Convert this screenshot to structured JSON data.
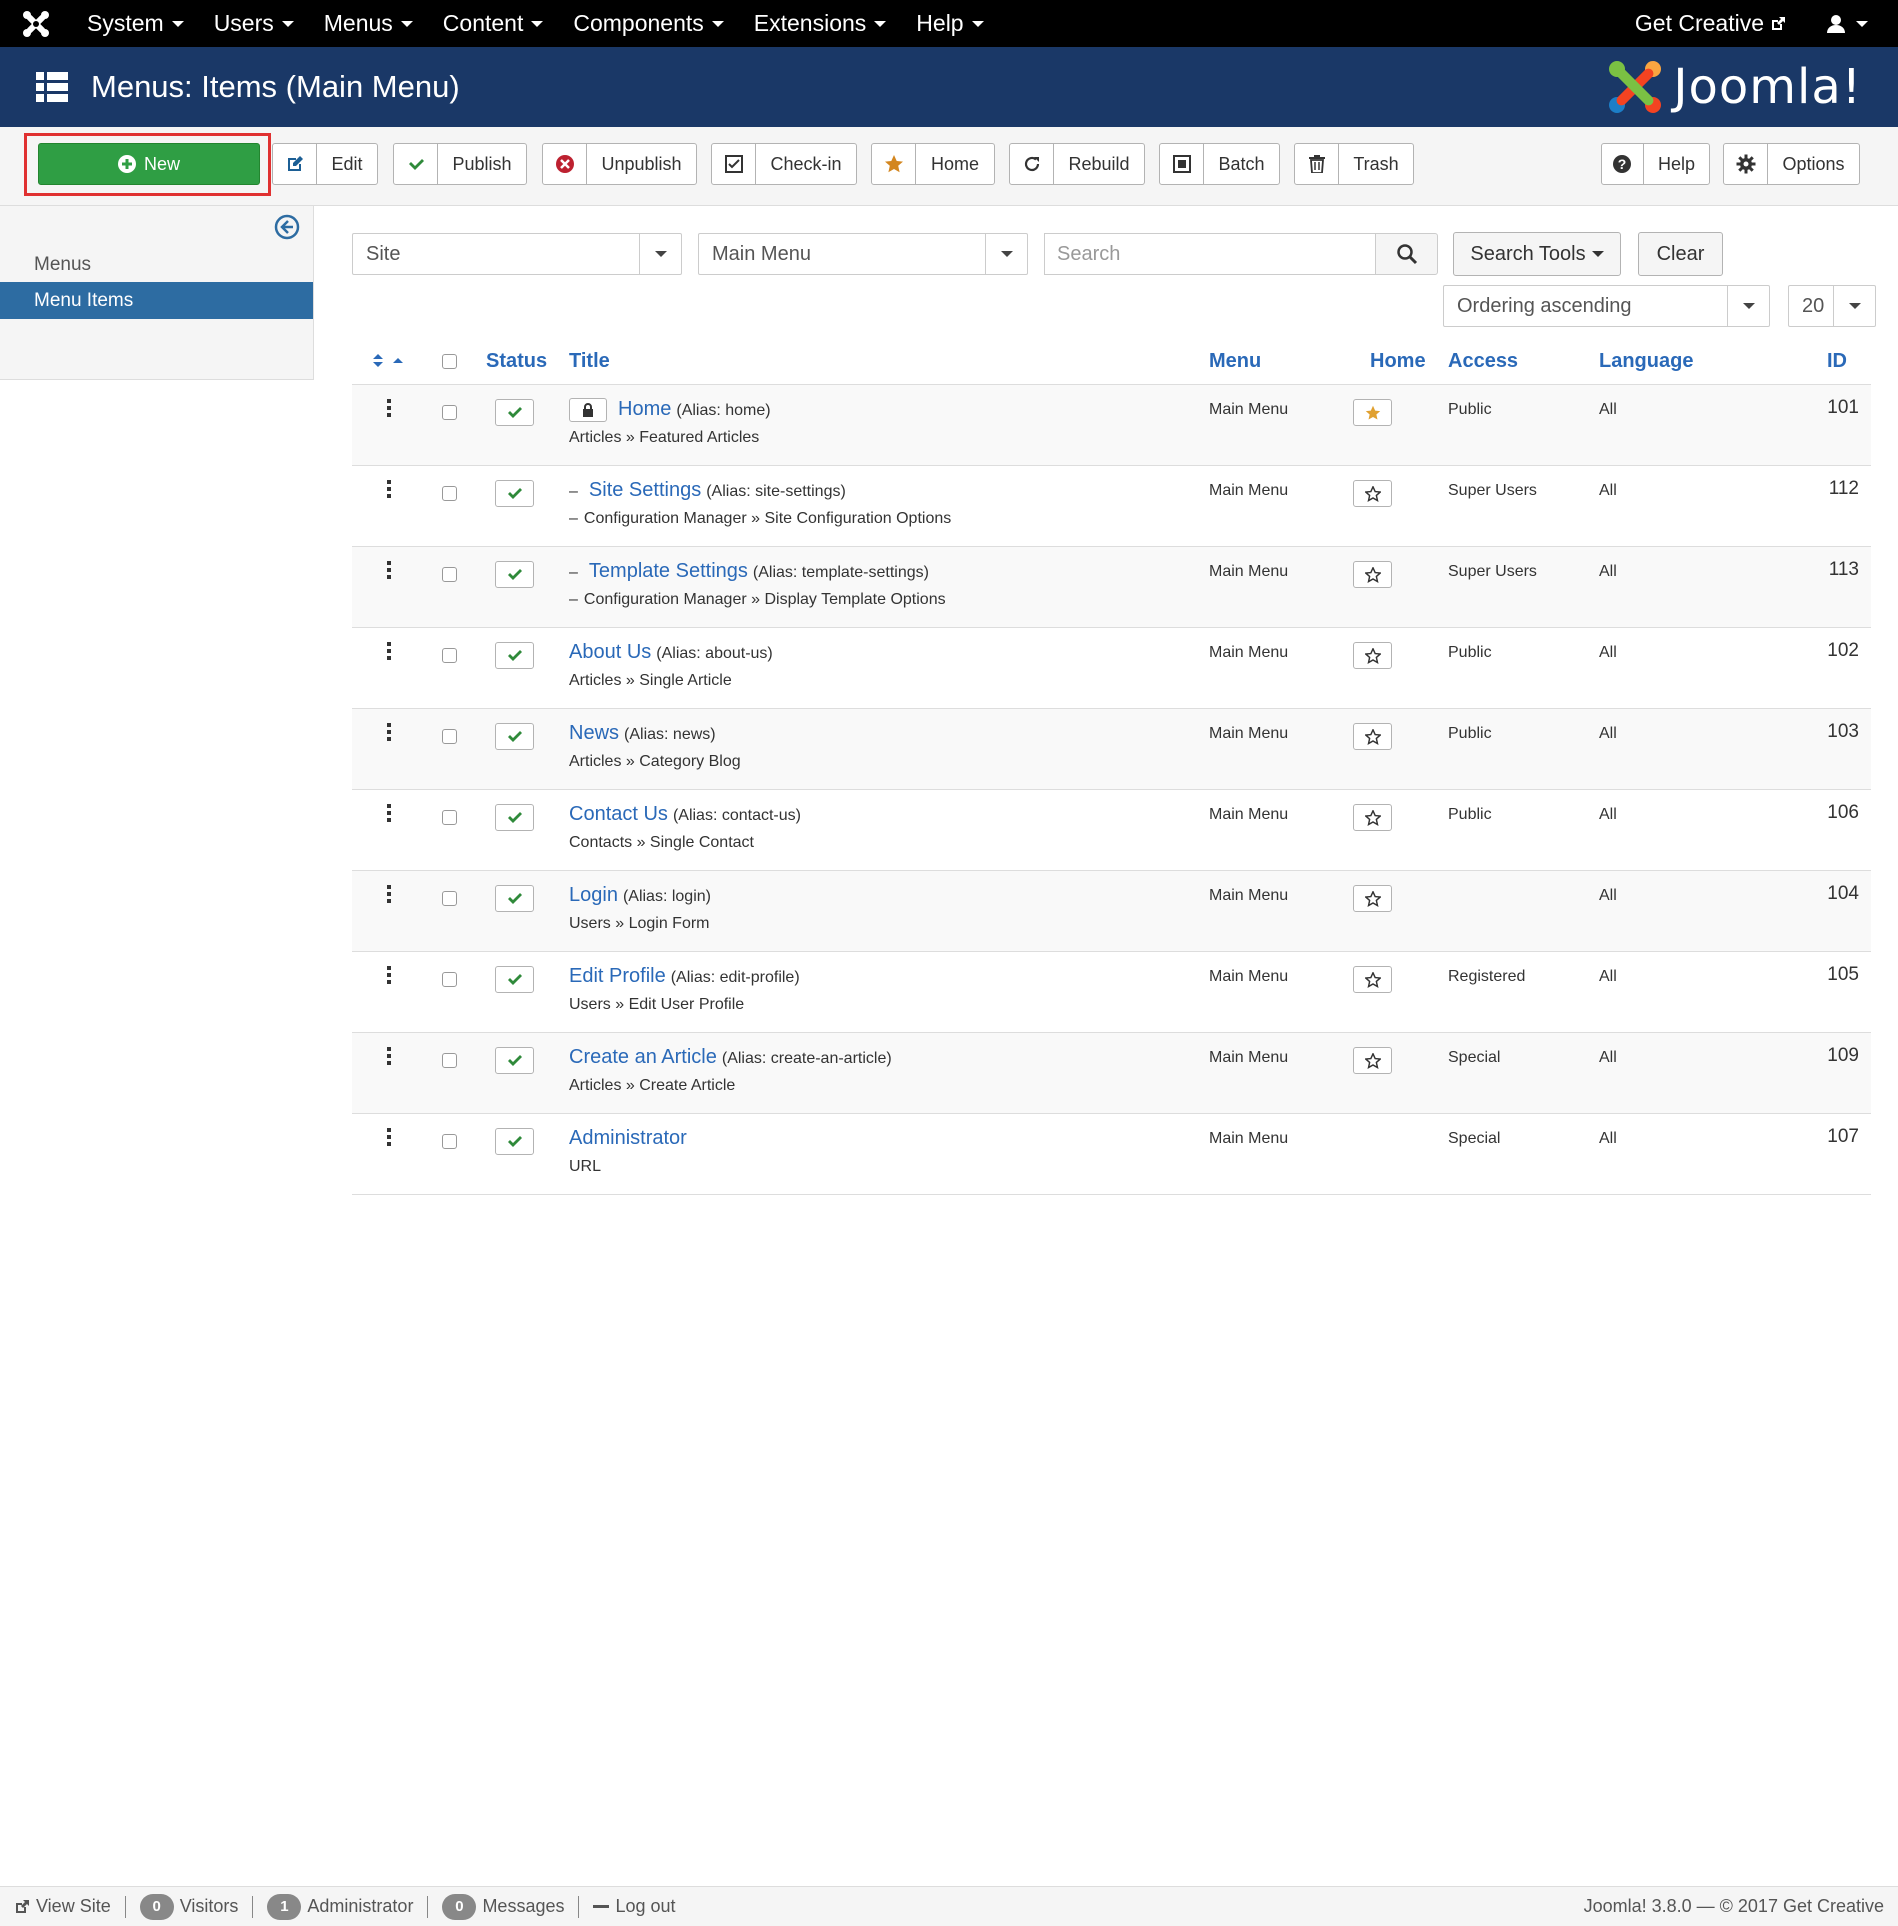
{
  "topnav": {
    "menu": [
      {
        "label": "System"
      },
      {
        "label": "Users"
      },
      {
        "label": "Menus"
      },
      {
        "label": "Content"
      },
      {
        "label": "Components"
      },
      {
        "label": "Extensions"
      },
      {
        "label": "Help"
      }
    ],
    "get_creative": "Get Creative"
  },
  "header": {
    "title": "Menus: Items (Main Menu)",
    "brand": "Joomla!"
  },
  "toolbar": {
    "new": "New",
    "edit": "Edit",
    "publish": "Publish",
    "unpublish": "Unpublish",
    "checkin": "Check-in",
    "home": "Home",
    "rebuild": "Rebuild",
    "batch": "Batch",
    "trash": "Trash",
    "help": "Help",
    "options": "Options"
  },
  "sidebar": {
    "items": [
      {
        "label": "Menus"
      },
      {
        "label": "Menu Items"
      }
    ]
  },
  "filters": {
    "client": "Site",
    "menu": "Main Menu",
    "search_placeholder": "Search",
    "search_tools": "Search Tools",
    "clear": "Clear",
    "ordering": "Ordering ascending",
    "limit": "20"
  },
  "table": {
    "headers": {
      "status": "Status",
      "title": "Title",
      "menu": "Menu",
      "home": "Home",
      "access": "Access",
      "language": "Language",
      "id": "ID"
    },
    "rows": [
      {
        "title": "Home",
        "alias": "(Alias: home)",
        "subtitle": "Articles » Featured Articles",
        "menu": "Main Menu",
        "access": "Public",
        "language": "All",
        "id": "101"
      },
      {
        "title": "Site Settings",
        "alias": "(Alias: site-settings)",
        "subtitle": "Configuration Manager » Site Configuration Options",
        "menu": "Main Menu",
        "access": "Super Users",
        "language": "All",
        "id": "112"
      },
      {
        "title": "Template Settings",
        "alias": "(Alias: template-settings)",
        "subtitle": "Configuration Manager » Display Template Options",
        "menu": "Main Menu",
        "access": "Super Users",
        "language": "All",
        "id": "113"
      },
      {
        "title": "About Us",
        "alias": "(Alias: about-us)",
        "subtitle": "Articles » Single Article",
        "menu": "Main Menu",
        "access": "Public",
        "language": "All",
        "id": "102"
      },
      {
        "title": "News",
        "alias": "(Alias: news)",
        "subtitle": "Articles » Category Blog",
        "menu": "Main Menu",
        "access": "Public",
        "language": "All",
        "id": "103"
      },
      {
        "title": "Contact Us",
        "alias": "(Alias: contact-us)",
        "subtitle": "Contacts » Single Contact",
        "menu": "Main Menu",
        "access": "Public",
        "language": "All",
        "id": "106"
      },
      {
        "title": "Login",
        "alias": "(Alias: login)",
        "subtitle": "Users » Login Form",
        "menu": "Main Menu",
        "access": "",
        "language": "All",
        "id": "104"
      },
      {
        "title": "Edit Profile",
        "alias": "(Alias: edit-profile)",
        "subtitle": "Users » Edit User Profile",
        "menu": "Main Menu",
        "access": "Registered",
        "language": "All",
        "id": "105"
      },
      {
        "title": "Create an Article",
        "alias": "(Alias: create-an-article)",
        "subtitle": "Articles » Create Article",
        "menu": "Main Menu",
        "access": "Special",
        "language": "All",
        "id": "109"
      },
      {
        "title": "Administrator",
        "alias": "",
        "subtitle": "URL",
        "menu": "Main Menu",
        "access": "Special",
        "language": "All",
        "id": "107"
      }
    ]
  },
  "footer": {
    "view_site": "View Site",
    "visitors_count": "0",
    "visitors": "Visitors",
    "admin_count": "1",
    "administrator": "Administrator",
    "messages_count": "0",
    "messages": "Messages",
    "logout": "Log out",
    "version": "Joomla! 3.8.0",
    "copyright": "— © 2017 Get Creative"
  },
  "colors": {
    "header_bg": "#1a3867",
    "link": "#2a69b8",
    "new_button": "#2f9e44",
    "active_sidebar": "#2d6ca2",
    "highlight": "#e03131"
  }
}
